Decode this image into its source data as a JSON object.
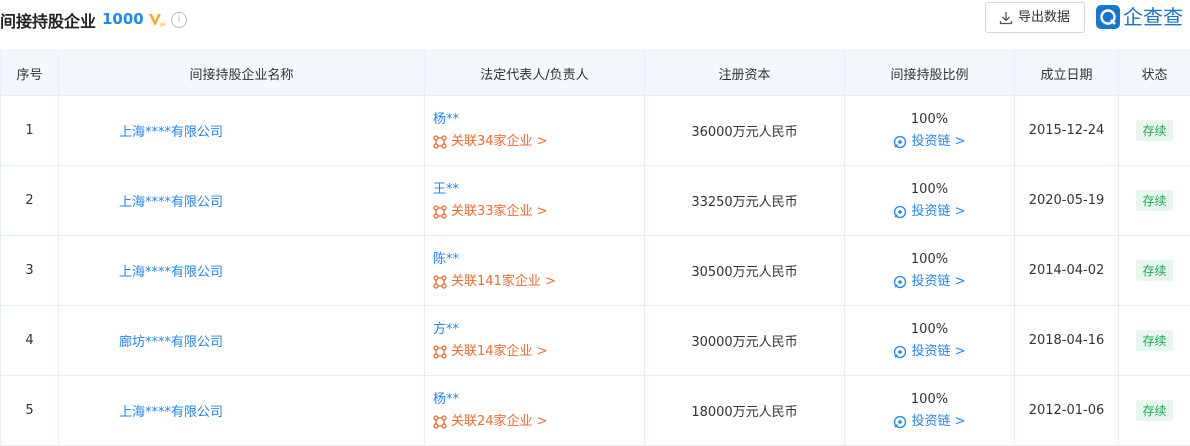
{
  "header": {
    "title": "间接持股企业",
    "count": "1000",
    "export_label": "导出数据",
    "brand_text": "企查查"
  },
  "columns": [
    "序号",
    "间接持股企业名称",
    "法定代表人/负责人",
    "注册资本",
    "间接持股比例",
    "成立日期",
    "状态"
  ],
  "rows": [
    {
      "no": "1",
      "name": "上海****有限公司",
      "person": "杨**",
      "related": "关联34家企业 >",
      "capital": "36000万元人民币",
      "ratio": "100%",
      "chain": "投资链 >",
      "date": "2015-12-24",
      "status": "存续"
    },
    {
      "no": "2",
      "name": "上海****有限公司",
      "person": "王**",
      "related": "关联33家企业 >",
      "capital": "33250万元人民币",
      "ratio": "100%",
      "chain": "投资链 >",
      "date": "2020-05-19",
      "status": "存续"
    },
    {
      "no": "3",
      "name": "上海****有限公司",
      "person": "陈**",
      "related": "关联141家企业 >",
      "capital": "30500万元人民币",
      "ratio": "100%",
      "chain": "投资链 >",
      "date": "2014-04-02",
      "status": "存续"
    },
    {
      "no": "4",
      "name": "廊坊****有限公司",
      "person": "方**",
      "related": "关联14家企业 >",
      "capital": "30000万元人民币",
      "ratio": "100%",
      "chain": "投资链 >",
      "date": "2018-04-16",
      "status": "存续"
    },
    {
      "no": "5",
      "name": "上海****有限公司",
      "person": "杨**",
      "related": "关联24家企业 >",
      "capital": "18000万元人民币",
      "ratio": "100%",
      "chain": "投资链 >",
      "date": "2012-01-06",
      "status": "存续"
    }
  ],
  "colors": {
    "accent": "#1e87f0",
    "related": "#f06c2c",
    "status_bg": "#e8f7ee",
    "status_text": "#1aaa55",
    "header_bg": "#f2f8fd"
  }
}
